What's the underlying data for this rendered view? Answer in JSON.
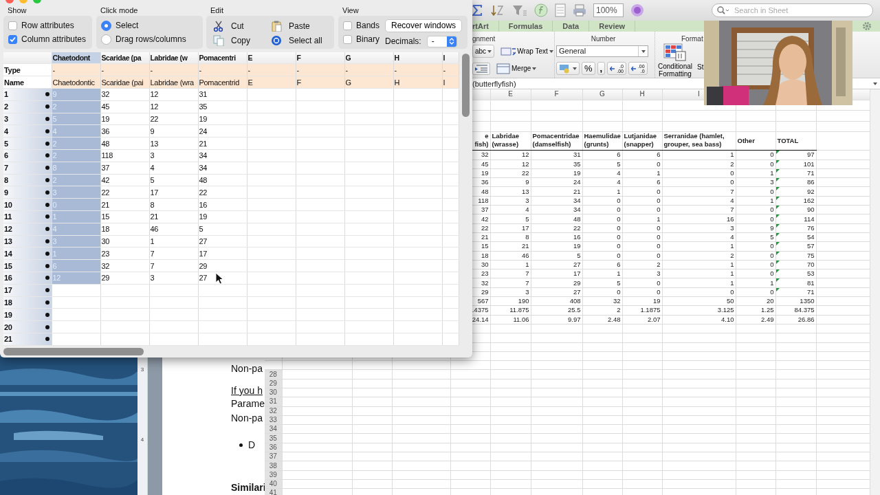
{
  "data_editor": {
    "show": {
      "title": "Show",
      "options": [
        {
          "label": "Row attributes",
          "checked": false
        },
        {
          "label": "Column attributes",
          "checked": true
        }
      ]
    },
    "click_mode": {
      "title": "Click mode",
      "options": [
        {
          "label": "Select",
          "selected": true
        },
        {
          "label": "Drag rows/columns",
          "selected": false
        }
      ]
    },
    "edit": {
      "title": "Edit",
      "actions": [
        {
          "label": "Cut",
          "kind": "cut"
        },
        {
          "label": "Paste",
          "kind": "paste"
        },
        {
          "label": "Copy",
          "kind": "copy"
        },
        {
          "label": "Select all",
          "kind": "select_all"
        }
      ]
    },
    "view": {
      "title": "View",
      "options": [
        {
          "label": "Bands",
          "checked": false
        },
        {
          "label": "Binary",
          "checked": false
        }
      ],
      "button": "Recover windows",
      "decimals_label": "Decimals:",
      "decimals_value": "-"
    },
    "row_labels": {
      "type": "Type",
      "name": "Name"
    },
    "columns": [
      {
        "header": "Chaetodont",
        "type": "-",
        "name": "Chaetodontic",
        "selected": true
      },
      {
        "header": "Scaridae (pa",
        "type": "-",
        "name": "Scaridae (pai",
        "selected": false
      },
      {
        "header": "Labridae (w",
        "type": "-",
        "name": "Labridae (wra",
        "selected": false
      },
      {
        "header": "Pomacentri",
        "type": "-",
        "name": "Pomacentrid",
        "selected": false
      },
      {
        "header": "E",
        "type": "-",
        "name": "E",
        "selected": false
      },
      {
        "header": "F",
        "type": "-",
        "name": "F",
        "selected": false
      },
      {
        "header": "G",
        "type": "-",
        "name": "G",
        "selected": false
      },
      {
        "header": "H",
        "type": "-",
        "name": "H",
        "selected": false
      },
      {
        "header": "I",
        "type": "-",
        "name": "I",
        "selected": false
      }
    ],
    "rows": [
      {
        "label": "1",
        "cells": [
          {
            "text": "9",
            "selected": true
          },
          {
            "text": "32",
            "selected": false
          },
          {
            "text": "12",
            "selected": false
          },
          {
            "text": "31",
            "selected": false
          }
        ]
      },
      {
        "label": "2",
        "cells": [
          {
            "text": "2",
            "selected": true
          },
          {
            "text": "45",
            "selected": false
          },
          {
            "text": "12",
            "selected": false
          },
          {
            "text": "35",
            "selected": false
          }
        ]
      },
      {
        "label": "3",
        "cells": [
          {
            "text": "5",
            "selected": true
          },
          {
            "text": "19",
            "selected": false
          },
          {
            "text": "22",
            "selected": false
          },
          {
            "text": "19",
            "selected": false
          }
        ]
      },
      {
        "label": "4",
        "cells": [
          {
            "text": "4",
            "selected": true
          },
          {
            "text": "36",
            "selected": false
          },
          {
            "text": "9",
            "selected": false
          },
          {
            "text": "24",
            "selected": false
          }
        ]
      },
      {
        "label": "5",
        "cells": [
          {
            "text": "2",
            "selected": true
          },
          {
            "text": "48",
            "selected": false
          },
          {
            "text": "13",
            "selected": false
          },
          {
            "text": "21",
            "selected": false
          }
        ]
      },
      {
        "label": "6",
        "cells": [
          {
            "text": "2",
            "selected": true
          },
          {
            "text": "118",
            "selected": false
          },
          {
            "text": "3",
            "selected": false
          },
          {
            "text": "34",
            "selected": false
          }
        ]
      },
      {
        "label": "7",
        "cells": [
          {
            "text": "8",
            "selected": true
          },
          {
            "text": "37",
            "selected": false
          },
          {
            "text": "4",
            "selected": false
          },
          {
            "text": "34",
            "selected": false
          }
        ]
      },
      {
        "label": "8",
        "cells": [
          {
            "text": "2",
            "selected": true
          },
          {
            "text": "42",
            "selected": false
          },
          {
            "text": "5",
            "selected": false
          },
          {
            "text": "48",
            "selected": false
          }
        ]
      },
      {
        "label": "9",
        "cells": [
          {
            "text": "3",
            "selected": true
          },
          {
            "text": "22",
            "selected": false
          },
          {
            "text": "17",
            "selected": false
          },
          {
            "text": "22",
            "selected": false
          }
        ]
      },
      {
        "label": "10",
        "cells": [
          {
            "text": "0",
            "selected": true
          },
          {
            "text": "21",
            "selected": false
          },
          {
            "text": "8",
            "selected": false
          },
          {
            "text": "16",
            "selected": false
          }
        ]
      },
      {
        "label": "11",
        "cells": [
          {
            "text": "1",
            "selected": true
          },
          {
            "text": "15",
            "selected": false
          },
          {
            "text": "21",
            "selected": false
          },
          {
            "text": "19",
            "selected": false
          }
        ]
      },
      {
        "label": "12",
        "cells": [
          {
            "text": "4",
            "selected": true
          },
          {
            "text": "18",
            "selected": false
          },
          {
            "text": "46",
            "selected": false
          },
          {
            "text": "5",
            "selected": false
          }
        ]
      },
      {
        "label": "13",
        "cells": [
          {
            "text": "3",
            "selected": true
          },
          {
            "text": "30",
            "selected": false
          },
          {
            "text": "1",
            "selected": false
          },
          {
            "text": "27",
            "selected": false
          }
        ]
      },
      {
        "label": "14",
        "cells": [
          {
            "text": "1",
            "selected": true
          },
          {
            "text": "23",
            "selected": false
          },
          {
            "text": "7",
            "selected": false
          },
          {
            "text": "17",
            "selected": false
          }
        ]
      },
      {
        "label": "15",
        "cells": [
          {
            "text": "6",
            "selected": true
          },
          {
            "text": "32",
            "selected": false
          },
          {
            "text": "7",
            "selected": false
          },
          {
            "text": "29",
            "selected": false
          }
        ]
      },
      {
        "label": "16",
        "cells": [
          {
            "text": "12",
            "selected": true
          },
          {
            "text": "29",
            "selected": false
          },
          {
            "text": "3",
            "selected": false
          },
          {
            "text": "27",
            "selected": false
          }
        ]
      },
      {
        "label": "17",
        "cells": []
      },
      {
        "label": "18",
        "cells": []
      },
      {
        "label": "19",
        "cells": []
      },
      {
        "label": "20",
        "cells": []
      },
      {
        "label": "21",
        "cells": []
      }
    ]
  },
  "spreadsheet": {
    "toolbar": {
      "zoom": "100%",
      "search_placeholder": "Search in Sheet"
    },
    "tabs": [
      {
        "label": "rtArt",
        "selected": false
      },
      {
        "label": "Formulas",
        "selected": false
      },
      {
        "label": "Data",
        "selected": false
      },
      {
        "label": "Review",
        "selected": false
      }
    ],
    "ribbon": {
      "groups": [
        "gnment",
        "Number",
        "Format"
      ],
      "font_style": "abc",
      "wrap_text": "Wrap Text",
      "merge": "Merge",
      "number_format": "General",
      "percent": "%",
      "comma": ",",
      "decimal_buttons": [
        {
          "top": ".0",
          "bottom": ".00"
        },
        {
          "top": ".00",
          "bottom": ".0"
        }
      ],
      "conditional_formatting": "Conditional Formatting",
      "styles": "St"
    },
    "formula": "(butterflyfish)",
    "column_letters": [
      "E",
      "F",
      "G",
      "H",
      "I"
    ],
    "table": {
      "headers": [
        "e\nfish)",
        "Labridae\n(wrasse)",
        "Pomacentridae\n(damselfish)",
        "Haemulidae\n(grunts)",
        "Lutjanidae\n(snapper)",
        "Serranidae (hamlet,\ngrouper, sea bass)",
        "Other",
        "TOTAL"
      ],
      "rows": [
        {
          "cells": [
            "32",
            "12",
            "31",
            "6",
            "6",
            "1",
            "0",
            "97"
          ],
          "flagged": true
        },
        {
          "cells": [
            "45",
            "12",
            "35",
            "5",
            "0",
            "2",
            "0",
            "101"
          ],
          "flagged": true
        },
        {
          "cells": [
            "19",
            "22",
            "19",
            "4",
            "1",
            "0",
            "1",
            "71"
          ],
          "flagged": true
        },
        {
          "cells": [
            "36",
            "9",
            "24",
            "4",
            "6",
            "0",
            "3",
            "86"
          ],
          "flagged": true
        },
        {
          "cells": [
            "48",
            "13",
            "21",
            "1",
            "0",
            "7",
            "0",
            "92"
          ],
          "flagged": true
        },
        {
          "cells": [
            "118",
            "3",
            "34",
            "0",
            "0",
            "4",
            "1",
            "162"
          ],
          "flagged": true
        },
        {
          "cells": [
            "37",
            "4",
            "34",
            "0",
            "0",
            "7",
            "0",
            "90"
          ],
          "flagged": true
        },
        {
          "cells": [
            "42",
            "5",
            "48",
            "0",
            "1",
            "16",
            "0",
            "114"
          ],
          "flagged": true
        },
        {
          "cells": [
            "22",
            "17",
            "22",
            "0",
            "0",
            "3",
            "9",
            "76"
          ],
          "flagged": true
        },
        {
          "cells": [
            "21",
            "8",
            "16",
            "0",
            "0",
            "4",
            "5",
            "54"
          ],
          "flagged": true
        },
        {
          "cells": [
            "15",
            "21",
            "19",
            "0",
            "0",
            "1",
            "0",
            "57"
          ],
          "flagged": true
        },
        {
          "cells": [
            "18",
            "46",
            "5",
            "0",
            "0",
            "2",
            "0",
            "75"
          ],
          "flagged": true
        },
        {
          "cells": [
            "30",
            "1",
            "27",
            "6",
            "2",
            "1",
            "0",
            "70"
          ],
          "flagged": true
        },
        {
          "cells": [
            "23",
            "7",
            "17",
            "1",
            "3",
            "1",
            "0",
            "53"
          ],
          "flagged": true
        },
        {
          "cells": [
            "32",
            "7",
            "29",
            "5",
            "0",
            "1",
            "1",
            "81"
          ],
          "flagged": true
        },
        {
          "cells": [
            "29",
            "3",
            "27",
            "0",
            "0",
            "0",
            "0",
            "71"
          ],
          "flagged": true
        },
        {
          "cells": [
            "567",
            "190",
            "408",
            "32",
            "19",
            "50",
            "20",
            "1350"
          ],
          "flagged": false
        },
        {
          "cells": [
            ".4375",
            "11.875",
            "25.5",
            "2",
            "1.1875",
            "3.125",
            "1.25",
            "84.375"
          ],
          "flagged": false
        },
        {
          "cells": [
            "24.14",
            "11.06",
            "9.97",
            "2.48",
            "2.07",
            "4.10",
            "2.49",
            "26.86"
          ],
          "flagged": false
        }
      ]
    },
    "row_numbers": [
      "28",
      "29",
      "30",
      "31",
      "32",
      "33",
      "34",
      "35",
      "36",
      "37",
      "38",
      "39",
      "40",
      "41"
    ]
  },
  "document": {
    "ruler_labels": [
      "3",
      "4"
    ],
    "lines": [
      {
        "text": "Non-pa",
        "kind": "plain"
      },
      {
        "text": "If you h",
        "kind": "underlined"
      },
      {
        "text": "Parame",
        "kind": "plain"
      },
      {
        "text": "Non-pa",
        "kind": "plain"
      },
      {
        "text": "D",
        "kind": "bullet"
      },
      {
        "text": "Similari",
        "kind": "heading"
      }
    ]
  }
}
